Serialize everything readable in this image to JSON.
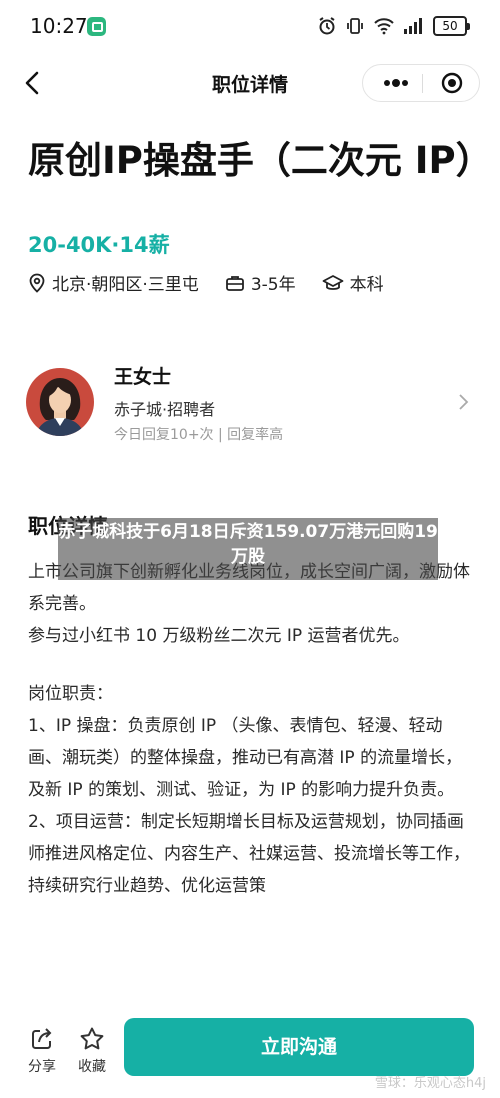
{
  "status_bar": {
    "time": "10:27",
    "battery": "50"
  },
  "nav": {
    "title": "职位详情"
  },
  "job": {
    "title": "原创IP操盘手（二次元 IP）",
    "salary": "20-40K·14薪",
    "location": "北京·朝阳区·三里屯",
    "experience": "3-5年",
    "education": "本科"
  },
  "recruiter": {
    "name": "王女士",
    "company_role": "赤子城·招聘者",
    "stats": "今日回复10+次 | 回复率高"
  },
  "description": {
    "section_title": "职位详情",
    "paragraphs": [
      "上市公司旗下创新孵化业务线岗位，成长空间广阔，激励体系完善。",
      "参与过小红书 10 万级粉丝二次元 IP 运营者优先。",
      "",
      "岗位职责：",
      "1、IP 操盘：负责原创 IP （头像、表情包、轻漫、轻动画、潮玩类）的整体操盘，推动已有高潜 IP 的流量增长，及新 IP 的策划、测试、验证，为 IP 的影响力提升负责。",
      "2、项目运营：制定长短期增长目标及运营规划，协同插画师推进风格定位、内容生产、社媒运营、投流增长等工作，持续研究行业趋势、优化运营策"
    ]
  },
  "overlay": {
    "headline": "赤子城科技于6月18日斥资159.07万港元回购19万股"
  },
  "bottom_bar": {
    "share": "分享",
    "favorite": "收藏",
    "cta": "立即沟通"
  },
  "watermark": "雪球：乐观心态h4j",
  "colors": {
    "accent": "#16b0a5",
    "avatar_bg": "#c94a3d"
  }
}
